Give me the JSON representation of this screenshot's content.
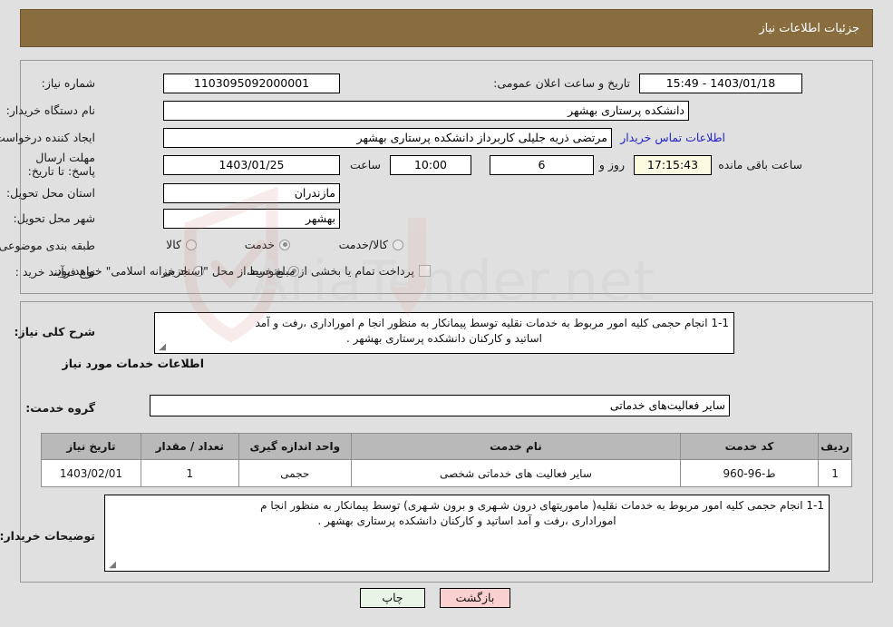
{
  "header": {
    "title": "جزئیات اطلاعات نیاز"
  },
  "top": {
    "need_number_label": "شماره نیاز:",
    "need_number_value": "1103095092000001",
    "announce_label": "تاریخ و ساعت اعلان عمومی:",
    "announce_value": "1403/01/18 - 15:49",
    "buyer_org_label": "نام دستگاه خریدار:",
    "buyer_org_value": "دانشکده پرستاری بهشهر",
    "creator_label": "ایجاد کننده درخواست:",
    "creator_value": "مرتضی ذریه جلیلی کاربرداز دانشکده پرستاری بهشهر",
    "contact_link": "اطلاعات تماس خریدار",
    "deadline_label": "مهلت ارسال پاسخ: تا تاریخ:",
    "deadline_date": "1403/01/25",
    "hour_label": "ساعت",
    "deadline_time": "10:00",
    "days_value": "6",
    "days_label": "روز و",
    "countdown_value": "17:15:43",
    "countdown_label": "ساعت باقی مانده",
    "province_label": "استان محل تحویل:",
    "province_value": "مازندران",
    "city_label": "شهر محل تحویل:",
    "city_value": "بهشهر",
    "category_label": "طبقه بندی موضوعی:",
    "category_options": [
      {
        "label": "کالا",
        "selected": false
      },
      {
        "label": "خدمت",
        "selected": true
      },
      {
        "label": "کالا/خدمت",
        "selected": false
      }
    ],
    "process_label": "نوع فرآیند خرید :",
    "process_options": [
      {
        "label": "جزیی",
        "selected": false
      },
      {
        "label": "متوسط",
        "selected": true
      }
    ],
    "treasury_checkbox_label": "پرداخت تمام یا بخشی از مبلغ خرید،از محل \"اسناد خزانه اسلامی\" خواهد بود.",
    "treasury_checked": false
  },
  "middle": {
    "general_desc_label": "شرح کلی نیاز:",
    "general_desc_line1": "1-1   انجام حجمی کلیه امور مربوط به خدمات نقلیه توسط پیمانکار به منظور انجا م اموراداری ،رفت و آمد",
    "general_desc_line2": "اساتید و کارکنان دانشکده پرستاری بهشهر  .",
    "services_info_heading": "اطلاعات خدمات مورد نیاز",
    "service_group_label": "گروه خدمت:",
    "service_group_value": "سایر فعالیت‌های خدماتی",
    "table": {
      "headers": [
        "ردیف",
        "کد خدمت",
        "نام خدمت",
        "واحد اندازه گیری",
        "تعداد / مقدار",
        "تاریخ نیاز"
      ],
      "rows": [
        {
          "radif": "1",
          "code": "ط-96-960",
          "name": "سایر فعالیت های خدماتی شخصی",
          "unit": "حجمی",
          "qty": "1",
          "date": "1403/02/01"
        }
      ]
    },
    "buyer_notes_label": "توضیحات خریدار:",
    "buyer_notes_line1": "1-1   انجام حجمی کلیه امور مربوط به خدمات نقلیه(  ماموریتهای درون شـهری و برون شـهری) توسط پیمانکار به منظور انجا م",
    "buyer_notes_line2": "اموراداری ،رفت و آمد اساتید و کارکنان دانشکده پرستاری بهشهر  ."
  },
  "footer": {
    "print_label": "چاپ",
    "back_label": "بازگشت"
  },
  "colors": {
    "header_bg": "#8a6d3f",
    "page_bg": "#e0e0e0",
    "link": "#2222cc",
    "countdown_bg": "#fbfbe2",
    "print_bg": "#e8f5e6",
    "back_bg": "#fbd0d0",
    "table_header_bg": "#b9b9b9"
  }
}
